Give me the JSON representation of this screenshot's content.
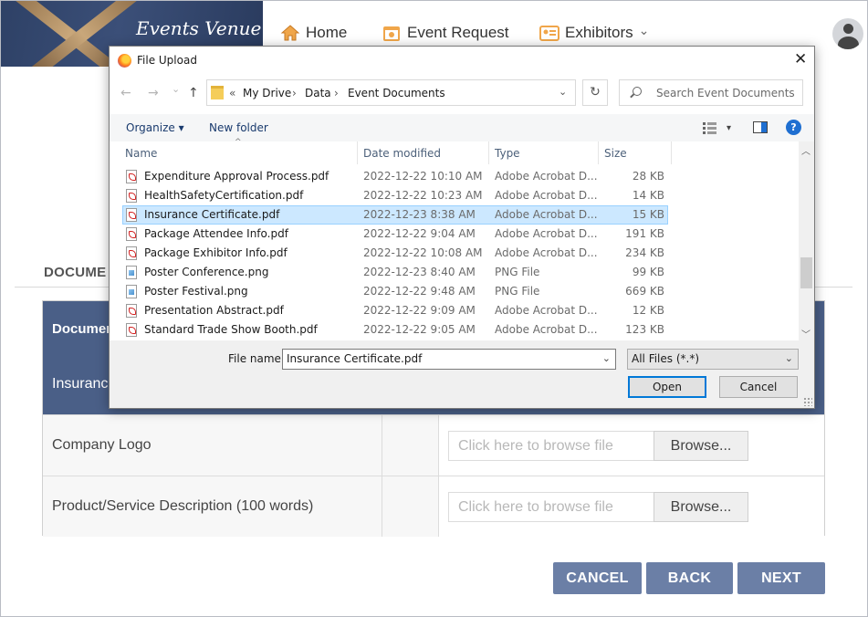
{
  "nav": {
    "logo_text": "Events Venue",
    "home": "Home",
    "event_request": "Event Request",
    "exhibitors": "Exhibitors",
    "exhibitors_caret": "⌄"
  },
  "page": {
    "section_title": "DOCUME",
    "table_header": "Documen",
    "rows": [
      {
        "label": "Insurance"
      },
      {
        "label": "Company Logo",
        "placeholder": "Click here to browse file",
        "browse": "Browse..."
      },
      {
        "label": "Product/Service Description (100 words)",
        "placeholder": "Click here to browse file",
        "browse": "Browse..."
      }
    ],
    "buttons": {
      "cancel": "CANCEL",
      "back": "BACK",
      "next": "NEXT"
    }
  },
  "dialog": {
    "title": "File Upload",
    "close": "✕",
    "nav": {
      "back": "←",
      "forward": "→",
      "recent": "⌄",
      "up": "↑"
    },
    "breadcrumb": {
      "sep_start": "«",
      "parts": [
        "My Drive",
        "Data",
        "Event Documents"
      ],
      "sep": "›"
    },
    "refresh": "↻",
    "search_placeholder": "Search Event Documents",
    "toolbar": {
      "organize": "Organize ▾",
      "new_folder": "New folder",
      "view_caret": "▾",
      "help": "?"
    },
    "columns": {
      "name": "Name",
      "date": "Date modified",
      "type": "Type",
      "size": "Size"
    },
    "files": [
      {
        "name": "Expenditure Approval Process.pdf",
        "date": "2022-12-22 10:10 AM",
        "type": "Adobe Acrobat D...",
        "size": "28 KB",
        "kind": "pdf"
      },
      {
        "name": "HealthSafetyCertification.pdf",
        "date": "2022-12-22 10:23 AM",
        "type": "Adobe Acrobat D...",
        "size": "14 KB",
        "kind": "pdf"
      },
      {
        "name": "Insurance Certificate.pdf",
        "date": "2022-12-23 8:38 AM",
        "type": "Adobe Acrobat D...",
        "size": "15 KB",
        "kind": "pdf",
        "selected": true
      },
      {
        "name": "Package Attendee Info.pdf",
        "date": "2022-12-22 9:04 AM",
        "type": "Adobe Acrobat D...",
        "size": "191 KB",
        "kind": "pdf"
      },
      {
        "name": "Package Exhibitor Info.pdf",
        "date": "2022-12-22 10:08 AM",
        "type": "Adobe Acrobat D...",
        "size": "234 KB",
        "kind": "pdf"
      },
      {
        "name": "Poster Conference.png",
        "date": "2022-12-23 8:40 AM",
        "type": "PNG File",
        "size": "99 KB",
        "kind": "png"
      },
      {
        "name": "Poster Festival.png",
        "date": "2022-12-22 9:48 AM",
        "type": "PNG File",
        "size": "669 KB",
        "kind": "png"
      },
      {
        "name": "Presentation Abstract.pdf",
        "date": "2022-12-22 9:09 AM",
        "type": "Adobe Acrobat D...",
        "size": "12 KB",
        "kind": "pdf"
      },
      {
        "name": "Standard Trade Show Booth.pdf",
        "date": "2022-12-22 9:05 AM",
        "type": "Adobe Acrobat D...",
        "size": "123 KB",
        "kind": "pdf"
      }
    ],
    "file_name_label": "File name:",
    "file_name_value": "Insurance Certificate.pdf",
    "file_type": "All Files (*.*)",
    "open": "Open",
    "cancel": "Cancel"
  },
  "colors": {
    "accent": "#4a5f87",
    "button": "#6b7fa6",
    "selection": "#cce8ff"
  }
}
